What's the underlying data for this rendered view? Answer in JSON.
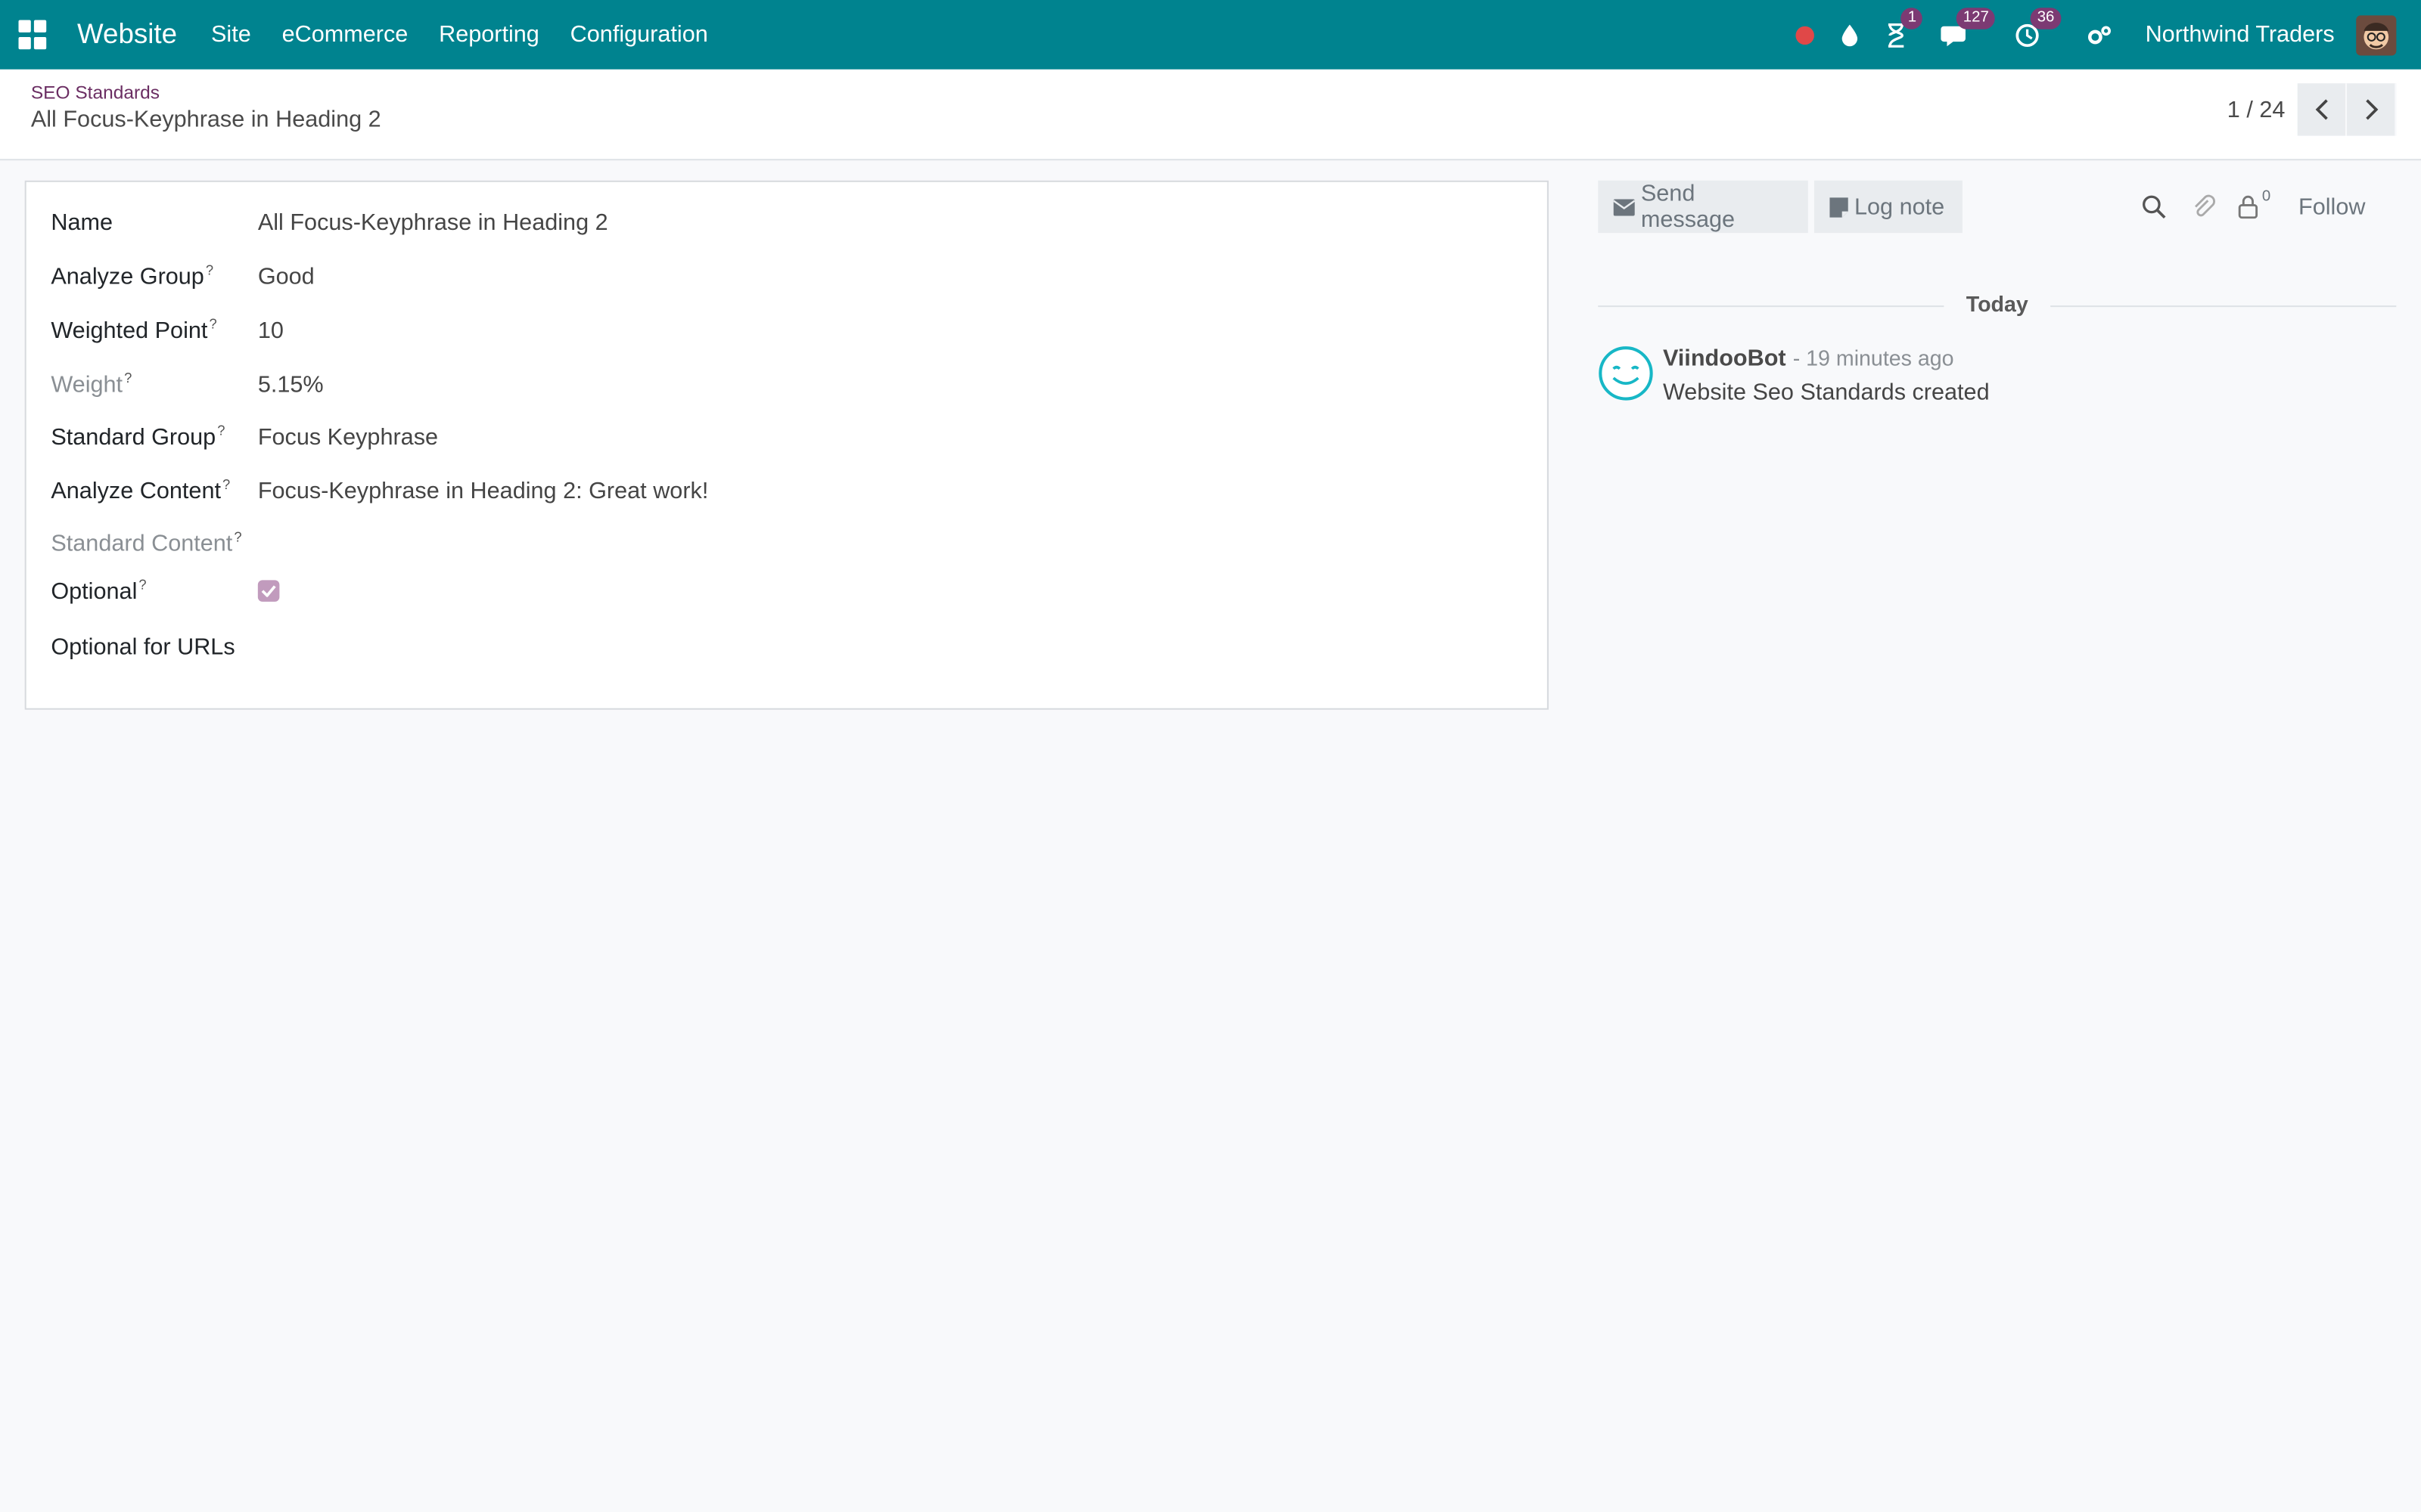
{
  "navbar": {
    "app_name": "Website",
    "menu": [
      "Site",
      "eCommerce",
      "Reporting",
      "Configuration"
    ],
    "badges": {
      "activity": "1",
      "messages": "127",
      "clock": "36"
    },
    "company": "Northwind Traders",
    "color": "#00838f",
    "badge_color": "#7c3a73"
  },
  "control": {
    "breadcrumb": "SEO Standards",
    "title": "All Focus-Keyphrase in Heading 2",
    "pager": "1 / 24"
  },
  "form": {
    "fields": [
      {
        "label": "Name",
        "value": "All Focus-Keyphrase in Heading 2"
      },
      {
        "label": "Analyze Group",
        "value": "Good"
      },
      {
        "label": "Weighted Point",
        "value": "10"
      },
      {
        "label": "Weight",
        "value": "5.15%"
      },
      {
        "label": "Standard Group",
        "value": "Focus Keyphrase"
      },
      {
        "label": "Analyze Content",
        "value": "Focus-Keyphrase in Heading 2: Great work!"
      },
      {
        "label": "Standard Content",
        "value": ""
      },
      {
        "label": "Optional",
        "value": ""
      },
      {
        "label": "Optional for URLs",
        "value": ""
      }
    ],
    "help_mark": "?",
    "optional_checked": true
  },
  "chatter": {
    "send_message": "Send message",
    "log_note": "Log note",
    "followers_count": "0",
    "follow": "Follow",
    "date_separator": "Today",
    "messages": [
      {
        "author": "ViindooBot",
        "date": "- 19 minutes ago",
        "body": "Website Seo Standards created"
      }
    ]
  }
}
